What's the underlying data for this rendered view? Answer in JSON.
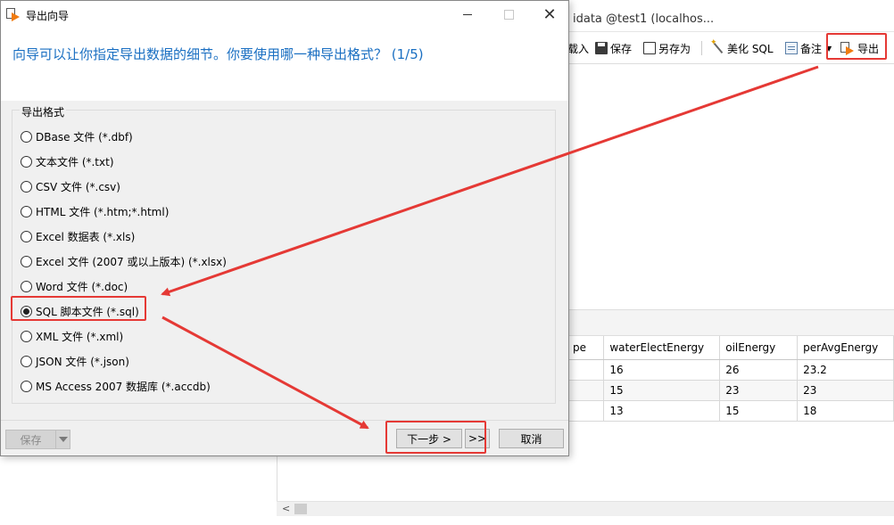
{
  "background_app": {
    "window_title": "idata @test1 (localhos...",
    "toolbar": {
      "load_fragment": "载入",
      "save_label": "保存",
      "save_as_label": "另存为",
      "beautify_label": "美化 SQL",
      "note_label": "备注",
      "export_label": "导出"
    },
    "grid": {
      "headers": [
        "pe",
        "waterElectEnergy",
        "oilEnergy",
        "perAvgEnergy"
      ],
      "rows": [
        [
          "",
          "16",
          "26",
          "23.2"
        ],
        [
          "",
          "15",
          "23",
          "23"
        ],
        [
          "",
          "13",
          "15",
          "18"
        ]
      ]
    },
    "scroll_left_arrow": "<"
  },
  "dialog": {
    "title": "导出向导",
    "heading": "向导可以让你指定导出数据的细节。你要使用哪一种导出格式？ (1/5)",
    "group_label": "导出格式",
    "formats": [
      {
        "label": "DBase 文件 (*.dbf)",
        "selected": false
      },
      {
        "label": "文本文件 (*.txt)",
        "selected": false
      },
      {
        "label": "CSV 文件 (*.csv)",
        "selected": false
      },
      {
        "label": "HTML 文件 (*.htm;*.html)",
        "selected": false
      },
      {
        "label": "Excel 数据表 (*.xls)",
        "selected": false
      },
      {
        "label": "Excel 文件 (2007 或以上版本) (*.xlsx)",
        "selected": false
      },
      {
        "label": "Word 文件 (*.doc)",
        "selected": false
      },
      {
        "label": "SQL 脚本文件 (*.sql)",
        "selected": true
      },
      {
        "label": "XML 文件 (*.xml)",
        "selected": false
      },
      {
        "label": "JSON 文件 (*.json)",
        "selected": false
      },
      {
        "label": "MS Access 2007 数据库 (*.accdb)",
        "selected": false
      }
    ],
    "footer": {
      "save_label": "保存",
      "next_label": "下一步 >",
      "finish_label": ">>",
      "cancel_label": "取消"
    }
  },
  "annotation_color": "#e53935"
}
